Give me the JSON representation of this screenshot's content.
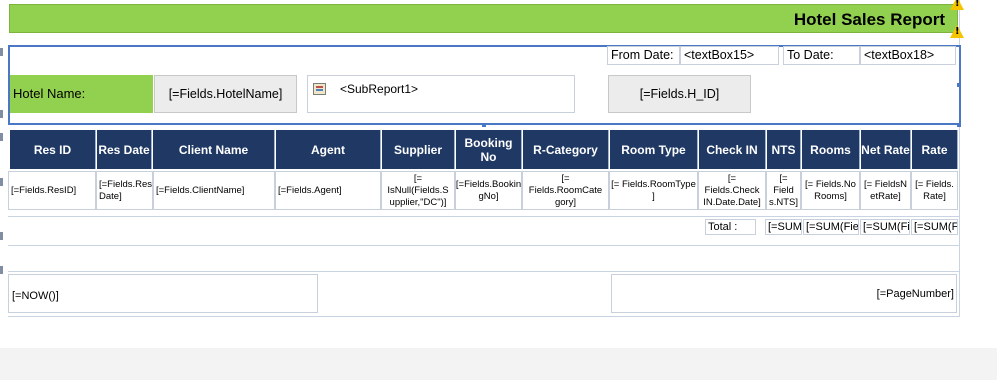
{
  "report": {
    "title": "Hotel Sales Report",
    "warning_icon": "warning-icon"
  },
  "params": {
    "from_date_label": "From Date:",
    "from_date_value": "<textBox15>",
    "to_date_label": "To Date:",
    "to_date_value": "<textBox18>",
    "hotel_name_label": "Hotel Name:",
    "hotel_name_field": "[=Fields.HotelName]",
    "subreport_label": "<SubReport1>",
    "subreport_icon": "subreport-icon",
    "hid_field": "[=Fields.H_ID]"
  },
  "table": {
    "headers": [
      "Res ID",
      "Res Date",
      "Client Name",
      "Agent",
      "Supplier",
      "Booking No",
      "R-Category",
      "Room Type",
      "Check IN",
      "NTS",
      "Rooms",
      "Net Rate",
      "Rate"
    ],
    "cells": [
      "[=Fields.ResID]",
      "[=Fields.Res Date]",
      "[=Fields.ClientName]",
      "[=Fields.Agent]",
      "[= IsNull(Fields.S upplier,\"DC\")]",
      "[=Fields.Bookin gNo]",
      "[= Fields.RoomCate gory]",
      "[= Fields.RoomType ]",
      "[= Fields.Check IN.Date.Date]",
      "[= Field s.NTS]",
      "[= Fields.No Rooms]",
      "[= FieldsN etRate]",
      "[= Fields. Rate]"
    ],
    "total_label": "Total :",
    "sums": [
      "[=SUM",
      "[=SUM(Fiel",
      "[=SUM(Fi",
      "[=SUM(F"
    ]
  },
  "footer": {
    "now_field": "[=NOW()]",
    "page_number_field": "[=PageNumber]"
  },
  "colors": {
    "green": "#92d050",
    "header_navy": "#1f3864",
    "selection_blue": "#4a78c4",
    "warning": "#f5c400"
  }
}
